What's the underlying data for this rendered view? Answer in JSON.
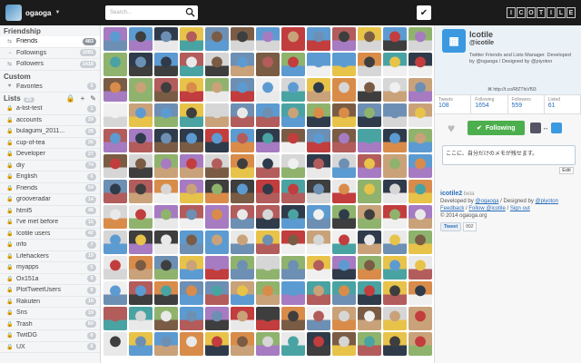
{
  "topbar": {
    "username": "ogaoga",
    "search_placeholder": "Search...",
    "logo_letters": [
      "I",
      "C",
      "O",
      "T",
      "I",
      "L",
      "E"
    ]
  },
  "sidebar": {
    "friendship_title": "Friendship",
    "friendship": [
      {
        "label": "Friends",
        "count": "483",
        "icon": "arrow-left-icon",
        "active": true
      },
      {
        "label": "Followings",
        "count": "1081",
        "icon": "arrow-right-icon"
      },
      {
        "label": "Followers",
        "count": "1418",
        "icon": "arrow-left-icon"
      }
    ],
    "custom_title": "Custom",
    "custom": [
      {
        "label": "Favorites",
        "count": "5",
        "icon": "heart-icon"
      }
    ],
    "lists_title": "Lists",
    "lists_count": "25",
    "lists": [
      {
        "label": "a-list-test",
        "count": "1"
      },
      {
        "label": "accounts",
        "count": "29"
      },
      {
        "label": "bulagumi_2011...",
        "count": "28"
      },
      {
        "label": "cup-of-tea",
        "count": "26"
      },
      {
        "label": "Developer",
        "count": "27"
      },
      {
        "label": "diy",
        "count": "74"
      },
      {
        "label": "English",
        "count": "6"
      },
      {
        "label": "Friends",
        "count": "54"
      },
      {
        "label": "grooveradar",
        "count": "14"
      },
      {
        "label": "html5",
        "count": "48"
      },
      {
        "label": "I've met before",
        "count": "15"
      },
      {
        "label": "Icotile users",
        "count": "42"
      },
      {
        "label": "info",
        "count": "7"
      },
      {
        "label": "Lifehackers",
        "count": "19"
      },
      {
        "label": "myapps",
        "count": "5"
      },
      {
        "label": "Ox151a",
        "count": "9"
      },
      {
        "label": "PlotTweetUsers",
        "count": "6"
      },
      {
        "label": "Rakuten",
        "count": "18"
      },
      {
        "label": "Sns",
        "count": "19"
      },
      {
        "label": "Trash",
        "count": "60"
      },
      {
        "label": "TwitDG",
        "count": "6"
      },
      {
        "label": "UX",
        "count": "6"
      }
    ]
  },
  "profile": {
    "name": "Icotile",
    "handle": "@icotile",
    "description": "Twitter Friends and Lists Manager.  Developed by @ogaoga / Designed by @piyoton",
    "link": "http://t.co/RfZTfsVf93",
    "stats": [
      {
        "label": "Tweets",
        "value": "108"
      },
      {
        "label": "Following",
        "value": "1654"
      },
      {
        "label": "Followers",
        "value": "559"
      },
      {
        "label": "Listed",
        "value": "61"
      }
    ],
    "follow_label": "Following",
    "memo_text": "ここに、自分だけのメモが残せます。",
    "edit_label": "Edit"
  },
  "footer": {
    "app_title": "icotile2",
    "app_beta": "beta",
    "developed_prefix": "Developed by ",
    "developer": "@ogaoga",
    "designed_prefix": " / Designed by ",
    "designer": "@piyoton",
    "feedback": "Feedback",
    "follow": "Follow @icotile",
    "signout": "Sign out",
    "copyright": "© 2014 ogaoga.org",
    "tweet_label": "Tweet",
    "tweet_count": "892"
  }
}
